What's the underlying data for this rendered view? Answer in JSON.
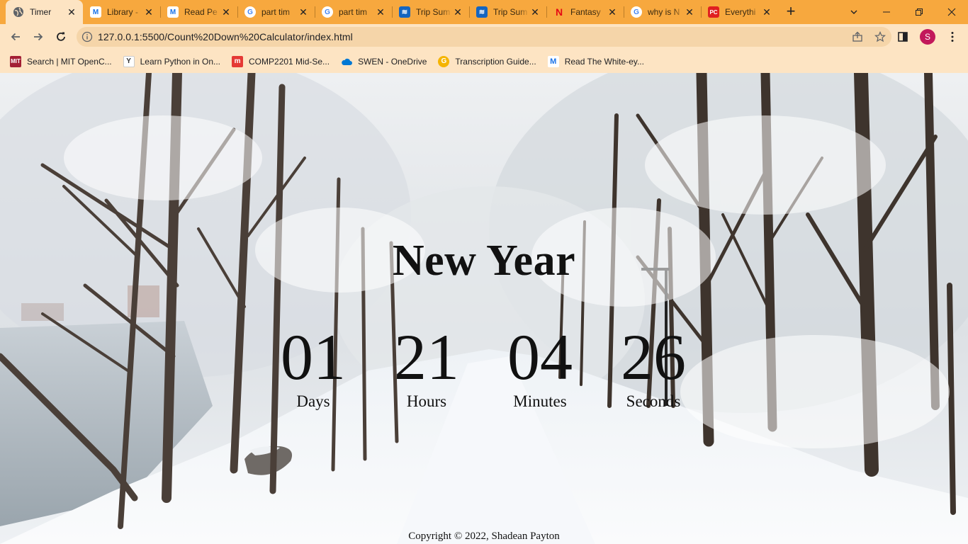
{
  "browser": {
    "tabs": [
      {
        "title": "Timer",
        "favicon": "globe-icon",
        "color": "#5f6368",
        "active": true
      },
      {
        "title": "Library -",
        "favicon": "M",
        "color": "#1a73e8",
        "active": false
      },
      {
        "title": "Read Pe",
        "favicon": "M",
        "color": "#1a73e8",
        "active": false
      },
      {
        "title": "part tim",
        "favicon": "G",
        "color": "#4285f4",
        "active": false
      },
      {
        "title": "part tim",
        "favicon": "G",
        "color": "#4285f4",
        "active": false
      },
      {
        "title": "Trip Sum",
        "favicon": "≋",
        "color": "#1565c0",
        "active": false
      },
      {
        "title": "Trip Sum",
        "favicon": "≋",
        "color": "#1565c0",
        "active": false
      },
      {
        "title": "Fantasy",
        "favicon": "N",
        "color": "#e50914",
        "active": false
      },
      {
        "title": "why is N",
        "favicon": "G",
        "color": "#4285f4",
        "active": false
      },
      {
        "title": "Everythi",
        "favicon": "PC",
        "color": "#e02020",
        "active": false
      }
    ],
    "close_glyph": "✕",
    "new_tab_glyph": "+",
    "url": "127.0.0.1:5500/Count%20Down%20Calculator/index.html",
    "profile_initial": "S",
    "bookmarks": [
      {
        "label": "Search | MIT OpenC...",
        "favicon": "MIT",
        "color": "#a31f34"
      },
      {
        "label": "Learn Python in On...",
        "favicon": "Y",
        "color": "#333333"
      },
      {
        "label": "COMP2201 Mid-Se...",
        "favicon": "m",
        "color": "#e53935"
      },
      {
        "label": "SWEN - OneDrive",
        "favicon": "cloud",
        "color": "#0078d4"
      },
      {
        "label": "Transcription Guide...",
        "favicon": "G",
        "color": "#f5b400"
      },
      {
        "label": "Read The White-ey...",
        "favicon": "M",
        "color": "#1a73e8"
      }
    ]
  },
  "page": {
    "headline": "New Year",
    "countdown": [
      {
        "value": "01",
        "label": "Days"
      },
      {
        "value": "21",
        "label": "Hours"
      },
      {
        "value": "04",
        "label": "Minutes"
      },
      {
        "value": "26",
        "label": "Seconds"
      }
    ],
    "copyright": "Copyright © 2022, Shadean Payton"
  },
  "colors": {
    "tabstrip": "#f7a83e",
    "toolbar": "#fde4c3",
    "omnibox": "#f5d5a9",
    "avatar": "#c2185b"
  }
}
